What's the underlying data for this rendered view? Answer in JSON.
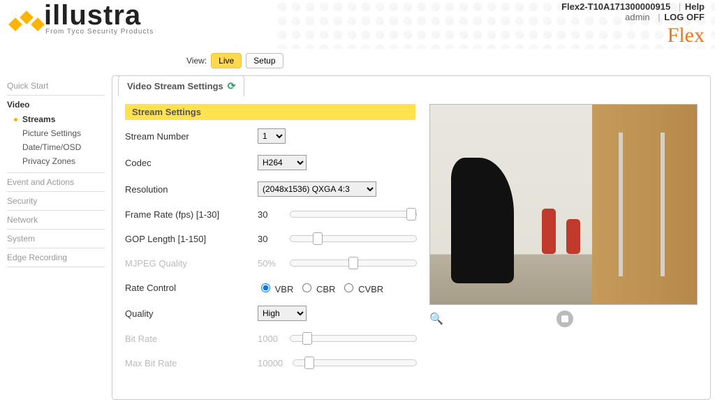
{
  "header": {
    "device_id": "Flex2-T10A171300000915",
    "user": "admin",
    "help": "Help",
    "logoff": "LOG OFF",
    "brand": "Flex",
    "logo_text": "illustra",
    "logo_sub": "From Tyco Security Products",
    "view_label": "View:",
    "view_live": "Live",
    "view_setup": "Setup"
  },
  "sidebar": {
    "groups": [
      {
        "title": "Quick Start"
      },
      {
        "title": "Video",
        "strong": true,
        "sub": [
          {
            "label": "Streams",
            "active": true
          },
          {
            "label": "Picture Settings"
          },
          {
            "label": "Date/Time/OSD"
          },
          {
            "label": "Privacy Zones"
          }
        ]
      },
      {
        "title": "Event and Actions"
      },
      {
        "title": "Security"
      },
      {
        "title": "Network"
      },
      {
        "title": "System"
      },
      {
        "title": "Edge Recording"
      }
    ]
  },
  "tab_title": "Video Stream Settings",
  "section_header": "Stream Settings",
  "form": {
    "stream_number": {
      "label": "Stream Number",
      "value": "1"
    },
    "codec": {
      "label": "Codec",
      "value": "H264"
    },
    "resolution": {
      "label": "Resolution",
      "value": "(2048x1536) QXGA 4:3"
    },
    "frame_rate": {
      "label": "Frame Rate (fps) [1-30]",
      "value": "30"
    },
    "gop": {
      "label": "GOP Length [1-150]",
      "value": "30"
    },
    "mjpeg": {
      "label": "MJPEG Quality",
      "value": "50%"
    },
    "rate_control": {
      "label": "Rate Control",
      "opt1": "VBR",
      "opt2": "CBR",
      "opt3": "CVBR"
    },
    "quality": {
      "label": "Quality",
      "value": "High"
    },
    "bitrate": {
      "label": "Bit Rate",
      "value": "1000"
    },
    "max_bitrate": {
      "label": "Max Bit Rate",
      "value": "10000"
    }
  }
}
